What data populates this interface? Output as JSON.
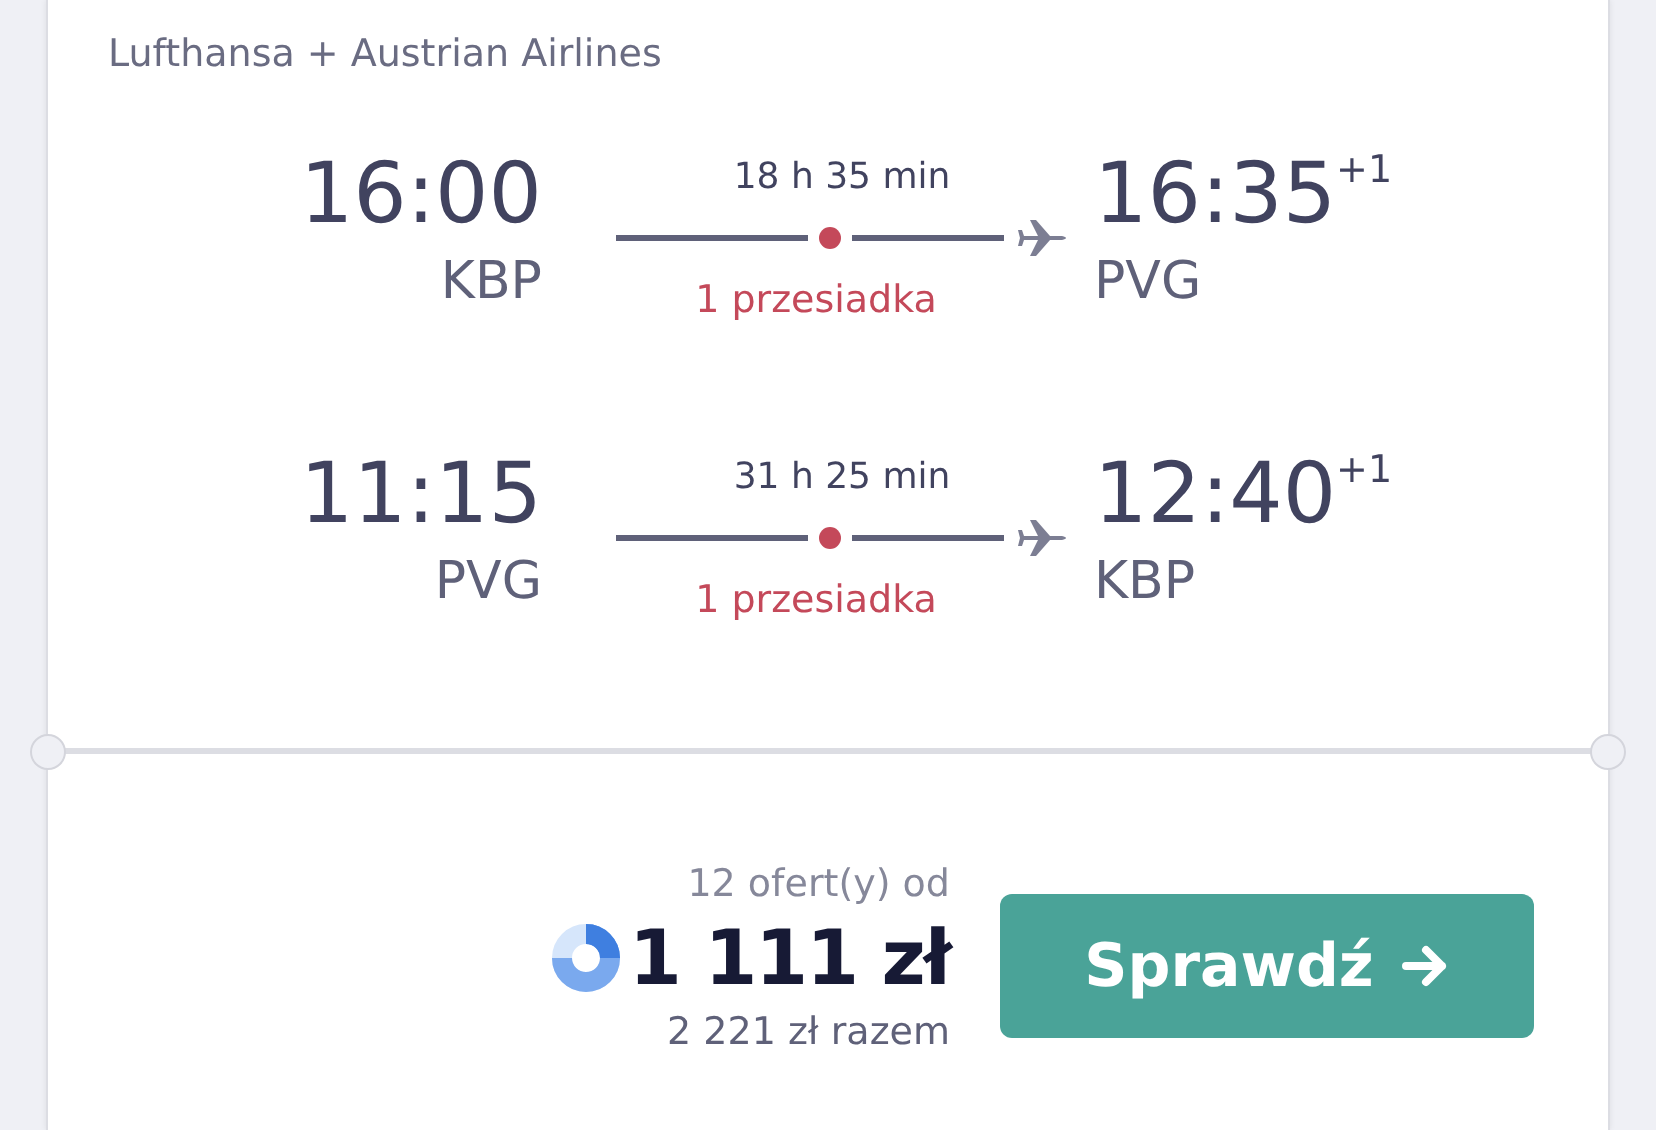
{
  "airline": "Lufthansa + Austrian Airlines",
  "legs": [
    {
      "departure": {
        "time": "16:00",
        "airport": "KBP"
      },
      "duration": "18 h 35 min",
      "stops": "1 przesiadka",
      "arrival": {
        "time": "16:35",
        "day_offset": "+1",
        "airport": "PVG"
      }
    },
    {
      "departure": {
        "time": "11:15",
        "airport": "PVG"
      },
      "duration": "31 h 25 min",
      "stops": "1 przesiadka",
      "arrival": {
        "time": "12:40",
        "day_offset": "+1",
        "airport": "KBP"
      }
    }
  ],
  "offers": {
    "count_label": "12 ofert(y) od",
    "price": "1 111 zł",
    "total": "2 221 zł razem",
    "button": "Sprawdź"
  }
}
